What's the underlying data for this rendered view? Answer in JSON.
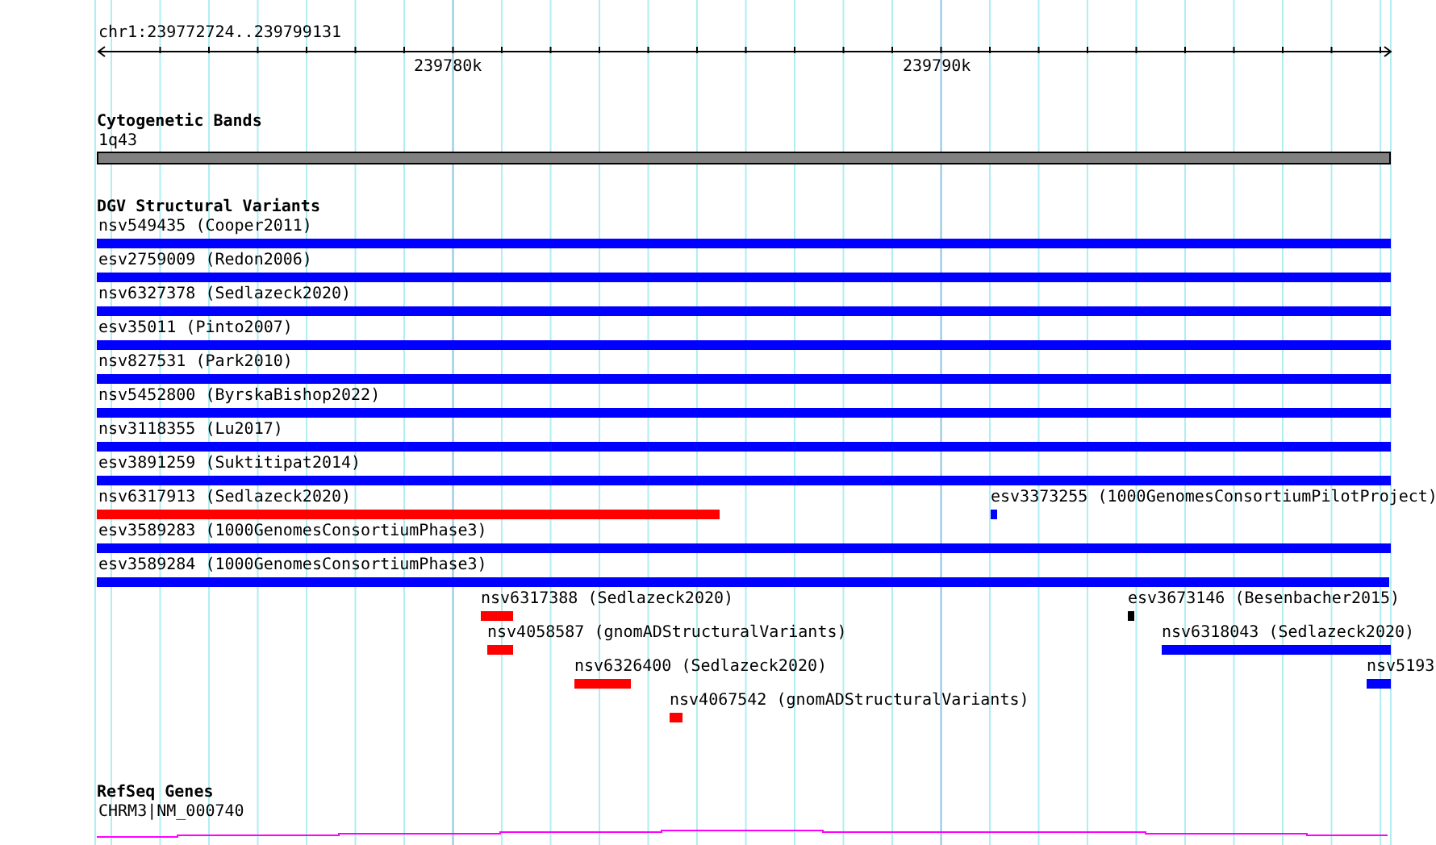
{
  "ruler": {
    "range": "chr1:239772724..239799131",
    "ticks": [
      "239780k",
      "239790k"
    ]
  },
  "tracks": [
    {
      "kind": "cytoband",
      "title": "Cytogenetic Bands",
      "label": "1q43"
    },
    {
      "kind": "variants",
      "title": "DGV Structural Variants",
      "lanes": [
        [
          {
            "label": "nsv549435 (Cooper2011)",
            "color": "#0000ff"
          }
        ],
        [
          {
            "label": "esv2759009 (Redon2006)",
            "color": "#0000ff"
          }
        ],
        [
          {
            "label": "nsv6327378 (Sedlazeck2020)",
            "color": "#0000ff"
          }
        ],
        [
          {
            "label": "esv35011 (Pinto2007)",
            "color": "#0000ff"
          }
        ],
        [
          {
            "label": "nsv827531 (Park2010)",
            "color": "#0000ff"
          }
        ],
        [
          {
            "label": "nsv5452800 (ByrskaBishop2022)",
            "color": "#0000ff"
          }
        ],
        [
          {
            "label": "nsv3118355 (Lu2017)",
            "color": "#0000ff"
          }
        ],
        [
          {
            "label": "esv3891259 (Suktitipat2014)",
            "color": "#0000ff"
          }
        ],
        [
          {
            "label": "nsv6317913 (Sedlazeck2020)",
            "color": "#ff0000"
          },
          {
            "label": "esv3373255 (1000GenomesConsortiumPilotProject)",
            "color": "#0000ff"
          }
        ],
        [
          {
            "label": "esv3589283 (1000GenomesConsortiumPhase3)",
            "color": "#0000ff"
          }
        ],
        [
          {
            "label": "esv3589284 (1000GenomesConsortiumPhase3)",
            "color": "#0000ff"
          }
        ],
        [
          {
            "label": "nsv6317388 (Sedlazeck2020)",
            "color": "#ff0000"
          },
          {
            "label": "esv3673146 (Besenbacher2015)",
            "color": "#000000"
          }
        ],
        [
          {
            "label": "nsv4058587 (gnomADStructuralVariants)",
            "color": "#ff0000"
          },
          {
            "label": "nsv6318043 (Sedlazeck2020)",
            "color": "#0000ff"
          }
        ],
        [
          {
            "label": "nsv6326400 (Sedlazeck2020)",
            "color": "#ff0000"
          },
          {
            "label": "nsv5193",
            "color": "#0000ff"
          }
        ],
        [
          {
            "label": "nsv4067542 (gnomADStructuralVariants)",
            "color": "#ff0000"
          }
        ]
      ]
    },
    {
      "kind": "genes",
      "title": "RefSeq Genes",
      "label": "CHRM3|NM_000740"
    }
  ]
}
